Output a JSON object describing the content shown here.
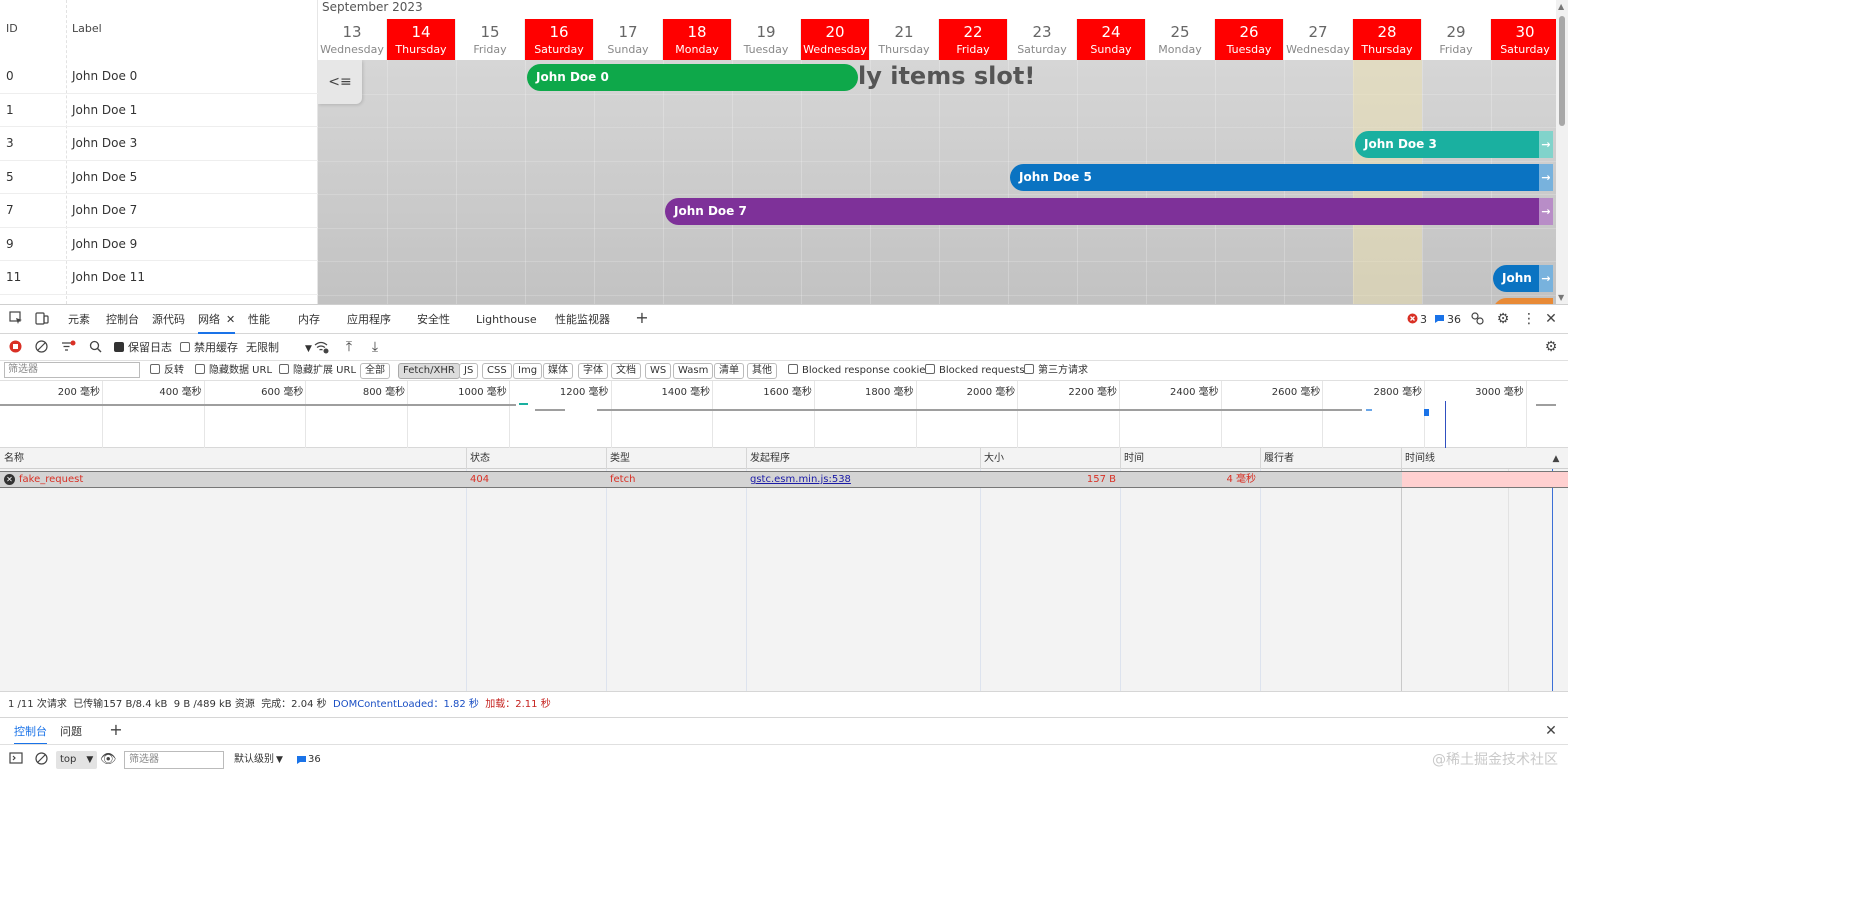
{
  "gantt": {
    "list": {
      "id_header": "ID",
      "label_header": "Label",
      "rows": [
        {
          "id": "0",
          "label": "John Doe 0"
        },
        {
          "id": "1",
          "label": "John Doe 1"
        },
        {
          "id": "3",
          "label": "John Doe 3"
        },
        {
          "id": "5",
          "label": "John Doe 5"
        },
        {
          "id": "7",
          "label": "John Doe 7"
        },
        {
          "id": "9",
          "label": "John Doe 9"
        },
        {
          "id": "11",
          "label": "John Doe 11"
        }
      ]
    },
    "month": "September 2023",
    "days": [
      {
        "num": "13",
        "name": "Wednesday",
        "red": false
      },
      {
        "num": "14",
        "name": "Thursday",
        "red": true
      },
      {
        "num": "15",
        "name": "Friday",
        "red": false
      },
      {
        "num": "16",
        "name": "Saturday",
        "red": true
      },
      {
        "num": "17",
        "name": "Sunday",
        "red": false
      },
      {
        "num": "18",
        "name": "Monday",
        "red": true
      },
      {
        "num": "19",
        "name": "Tuesday",
        "red": false
      },
      {
        "num": "20",
        "name": "Wednesday",
        "red": true
      },
      {
        "num": "21",
        "name": "Thursday",
        "red": false
      },
      {
        "num": "22",
        "name": "Friday",
        "red": true
      },
      {
        "num": "23",
        "name": "Saturday",
        "red": false
      },
      {
        "num": "24",
        "name": "Sunday",
        "red": true
      },
      {
        "num": "25",
        "name": "Monday",
        "red": false
      },
      {
        "num": "26",
        "name": "Tuesday",
        "red": true
      },
      {
        "num": "27",
        "name": "Wednesday",
        "red": false
      },
      {
        "num": "28",
        "name": "Thursday",
        "red": true
      },
      {
        "num": "29",
        "name": "Friday",
        "red": false
      },
      {
        "num": "30",
        "name": "Saturday",
        "red": true
      }
    ],
    "slot_text": "ly items slot!",
    "toggle_icon": "<≡",
    "highlight_day": "28",
    "bars": [
      {
        "label": "John Doe 0",
        "row": 0,
        "start_day": "16",
        "end_day": "20",
        "color": "#0ea84a",
        "continues": false
      },
      {
        "label": "John Doe 3",
        "row": 2,
        "start_day": "28",
        "end_day": "30",
        "color": "#1ab0a0",
        "continues": true
      },
      {
        "label": "John Doe 5",
        "row": 3,
        "start_day": "23",
        "end_day": "30",
        "color": "#0a73c2",
        "continues": true
      },
      {
        "label": "John Doe 7",
        "row": 4,
        "start_day": "18",
        "end_day": "30",
        "color": "#7e3199",
        "continues": true
      },
      {
        "label": "John",
        "row": 6,
        "start_day": "30",
        "end_day": "30",
        "color": "#0a73c2",
        "continues": true
      }
    ],
    "arrow_icon": "→"
  },
  "devtools": {
    "tabs": [
      "元素",
      "控制台",
      "源代码",
      "网络",
      "性能",
      "内存",
      "应用程序",
      "安全性",
      "Lighthouse",
      "性能监视器"
    ],
    "active_tab": "网络",
    "error_count": "3",
    "message_count": "36",
    "toolbar": {
      "preserve_log": "保留日志",
      "disable_cache": "禁用缓存",
      "throttle": "无限制"
    },
    "filter": {
      "placeholder": "筛选器",
      "invert": "反转",
      "hide_data_url": "隐藏数据 URL",
      "hide_ext_url": "隐藏扩展 URL",
      "types": [
        "全部",
        "Fetch/XHR",
        "JS",
        "CSS",
        "Img",
        "媒体",
        "字体",
        "文档",
        "WS",
        "Wasm",
        "清单",
        "其他"
      ],
      "active_type": "Fetch/XHR",
      "blocked_cookies": "Blocked response cookies",
      "blocked_requests": "Blocked requests",
      "third_party": "第三方请求"
    },
    "overview_ticks": [
      "200 毫秒",
      "400 毫秒",
      "600 毫秒",
      "800 毫秒",
      "1000 毫秒",
      "1200 毫秒",
      "1400 毫秒",
      "1600 毫秒",
      "1800 毫秒",
      "2000 毫秒",
      "2200 毫秒",
      "2400 毫秒",
      "2600 毫秒",
      "2800 毫秒",
      "3000 毫秒"
    ],
    "columns": [
      "名称",
      "状态",
      "类型",
      "发起程序",
      "大小",
      "时间",
      "履行者",
      "时间线"
    ],
    "request": {
      "name": "fake_request",
      "status": "404",
      "type": "fetch",
      "initiator": "gstc.esm.min.js:538",
      "size": "157 B",
      "time": "4 毫秒"
    },
    "status_bar": {
      "requests": "1 /11 次请求",
      "transferred": "已传输157 B/8.4 kB",
      "resources": "9 B /489 kB 资源",
      "finish": "完成：2.04 秒",
      "dom_loaded": "DOMContentLoaded：1.82 秒",
      "load": "加载：2.11 秒"
    },
    "drawer": {
      "tabs": [
        "控制台",
        "问题"
      ],
      "context": "top",
      "filter_placeholder": "筛选器",
      "level": "默认级别",
      "message_count": "36"
    },
    "watermark": "@稀土掘金技术社区"
  }
}
